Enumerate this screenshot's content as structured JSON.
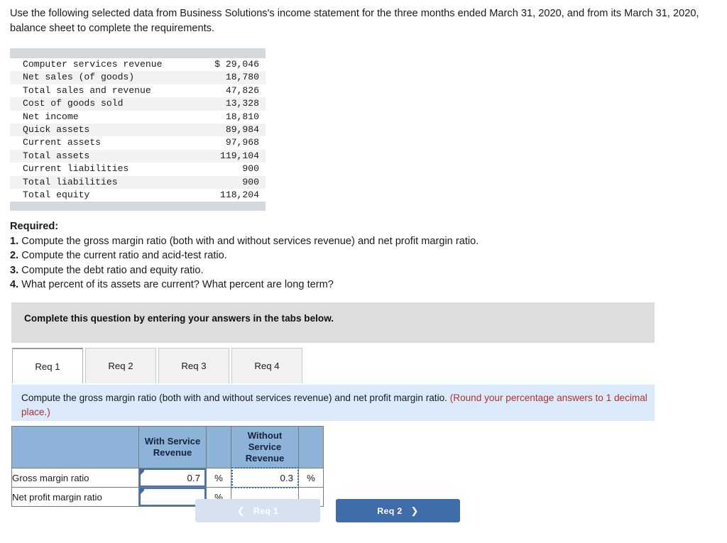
{
  "intro": "Use the following selected data from Business Solutions's income statement for the three months ended March 31, 2020, and from its March 31, 2020, balance sheet to complete the requirements.",
  "financials": {
    "rows": [
      {
        "label": "Computer services revenue",
        "amount": "$ 29,046"
      },
      {
        "label": "Net sales (of goods)",
        "amount": "18,780"
      },
      {
        "label": "Total sales and revenue",
        "amount": "47,826"
      },
      {
        "label": "Cost of goods sold",
        "amount": "13,328"
      },
      {
        "label": "Net income",
        "amount": "18,810"
      },
      {
        "label": "Quick assets",
        "amount": "89,984"
      },
      {
        "label": "Current assets",
        "amount": "97,968"
      },
      {
        "label": "Total assets",
        "amount": "119,104"
      },
      {
        "label": "Current liabilities",
        "amount": "900"
      },
      {
        "label": "Total liabilities",
        "amount": "900"
      },
      {
        "label": "Total equity",
        "amount": "118,204"
      }
    ]
  },
  "required": {
    "heading": "Required:",
    "items": [
      {
        "num": "1.",
        "text": "Compute the gross margin ratio (both with and without services revenue) and net profit margin ratio."
      },
      {
        "num": "2.",
        "text": "Compute the current ratio and acid-test ratio."
      },
      {
        "num": "3.",
        "text": "Compute the debt ratio and equity ratio."
      },
      {
        "num": "4.",
        "text": "What percent of its assets are current? What percent are long term?"
      }
    ]
  },
  "banner": {
    "text": "Complete this question by entering your answers in the tabs below."
  },
  "tabs": [
    {
      "label": "Req 1",
      "active": true
    },
    {
      "label": "Req 2",
      "active": false
    },
    {
      "label": "Req 3",
      "active": false
    },
    {
      "label": "Req 4",
      "active": false
    }
  ],
  "instruction": {
    "main": "Compute the gross margin ratio (both with and without services revenue) and net profit margin ratio.",
    "note": "(Round your percentage answers to 1 decimal place.)"
  },
  "answer_table": {
    "headers": {
      "corner": "",
      "with_service": "With Service Revenue",
      "without_service": "Without Service Revenue"
    },
    "rows": [
      {
        "label": "Gross margin ratio",
        "with_value": "0.7",
        "with_unit": "%",
        "without_value": "0.3",
        "without_unit": "%"
      },
      {
        "label": "Net profit margin ratio",
        "with_value": "",
        "with_unit": "%",
        "without_value": "",
        "without_unit": ""
      }
    ]
  },
  "nav": {
    "prev_label": "Req 1",
    "prev_icon": "chevron-left",
    "next_label": "Req 2",
    "next_icon": "chevron-right"
  },
  "colors": {
    "header_blue": "#8db3d9",
    "instruction_blue": "#dbeafa",
    "banner_gray": "#dddddd",
    "note_red": "#b03030",
    "button_blue": "#3f6cab",
    "button_disabled": "#d6e2f0",
    "input_border": "#4a74ad"
  }
}
